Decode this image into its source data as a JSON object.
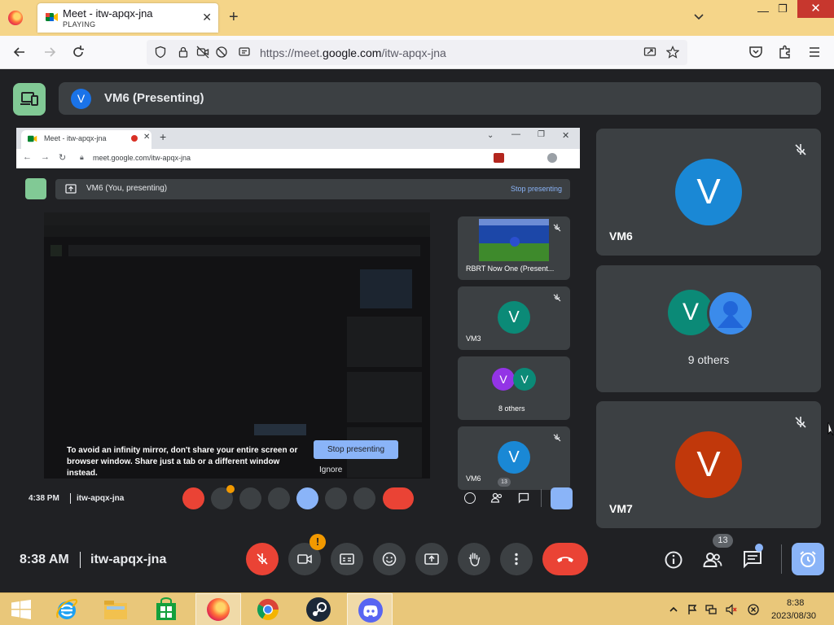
{
  "browser": {
    "tab_title": "Meet - itw-apqx-jna",
    "tab_status": "PLAYING",
    "tab_close": "✕",
    "new_tab": "+",
    "url_prefix": "https://meet.",
    "url_host": "google.com",
    "url_path": "/itw-apqx-jna",
    "window_min": "—",
    "window_max": "❐",
    "window_close": "✕"
  },
  "meet": {
    "presenter_initial": "V",
    "presenter_label": "VM6 (Presenting)",
    "clock": "8:38 AM",
    "meeting_code": "itw-apqx-jna",
    "participant_count": "13",
    "camera_warning": "!",
    "tiles": [
      {
        "name": "VM6",
        "initial": "V",
        "color": "#1a88d5"
      },
      {
        "label": "9 others",
        "initial": "V",
        "color": "#0b8a77"
      },
      {
        "name": "VM7",
        "initial": "V",
        "color": "#c1380b"
      }
    ],
    "colors": {
      "mic_off": "#ea4335",
      "accent": "#8ab4f8",
      "presenting_green": "#81c995"
    }
  },
  "shared_screen": {
    "tab_title": "Meet - itw-apqx-jna",
    "url": "meet.google.com/itw-apqx-jna",
    "presenter_label": "VM6 (You, presenting)",
    "stop_presenting_link": "Stop presenting",
    "infinity_message": "To avoid an infinity mirror, don't share your entire screen or browser window. Share just a tab or a different window instead.",
    "stop_presenting_button": "Stop presenting",
    "ignore": "Ignore",
    "tiles": [
      {
        "label": "RBRT Now One (Present..."
      },
      {
        "label": "VM3",
        "initial": "V"
      },
      {
        "label": "8 others",
        "initial": "V"
      },
      {
        "label": "VM6",
        "initial": "V"
      }
    ],
    "clock": "4:38 PM",
    "meeting_code": "itw-apqx-jna",
    "participant_count": "13"
  },
  "taskbar": {
    "time": "8:38",
    "date": "2023/08/30",
    "apps": [
      "start-button",
      "internet-explorer",
      "file-explorer",
      "windows-store",
      "firefox",
      "chrome",
      "steam",
      "discord"
    ]
  }
}
